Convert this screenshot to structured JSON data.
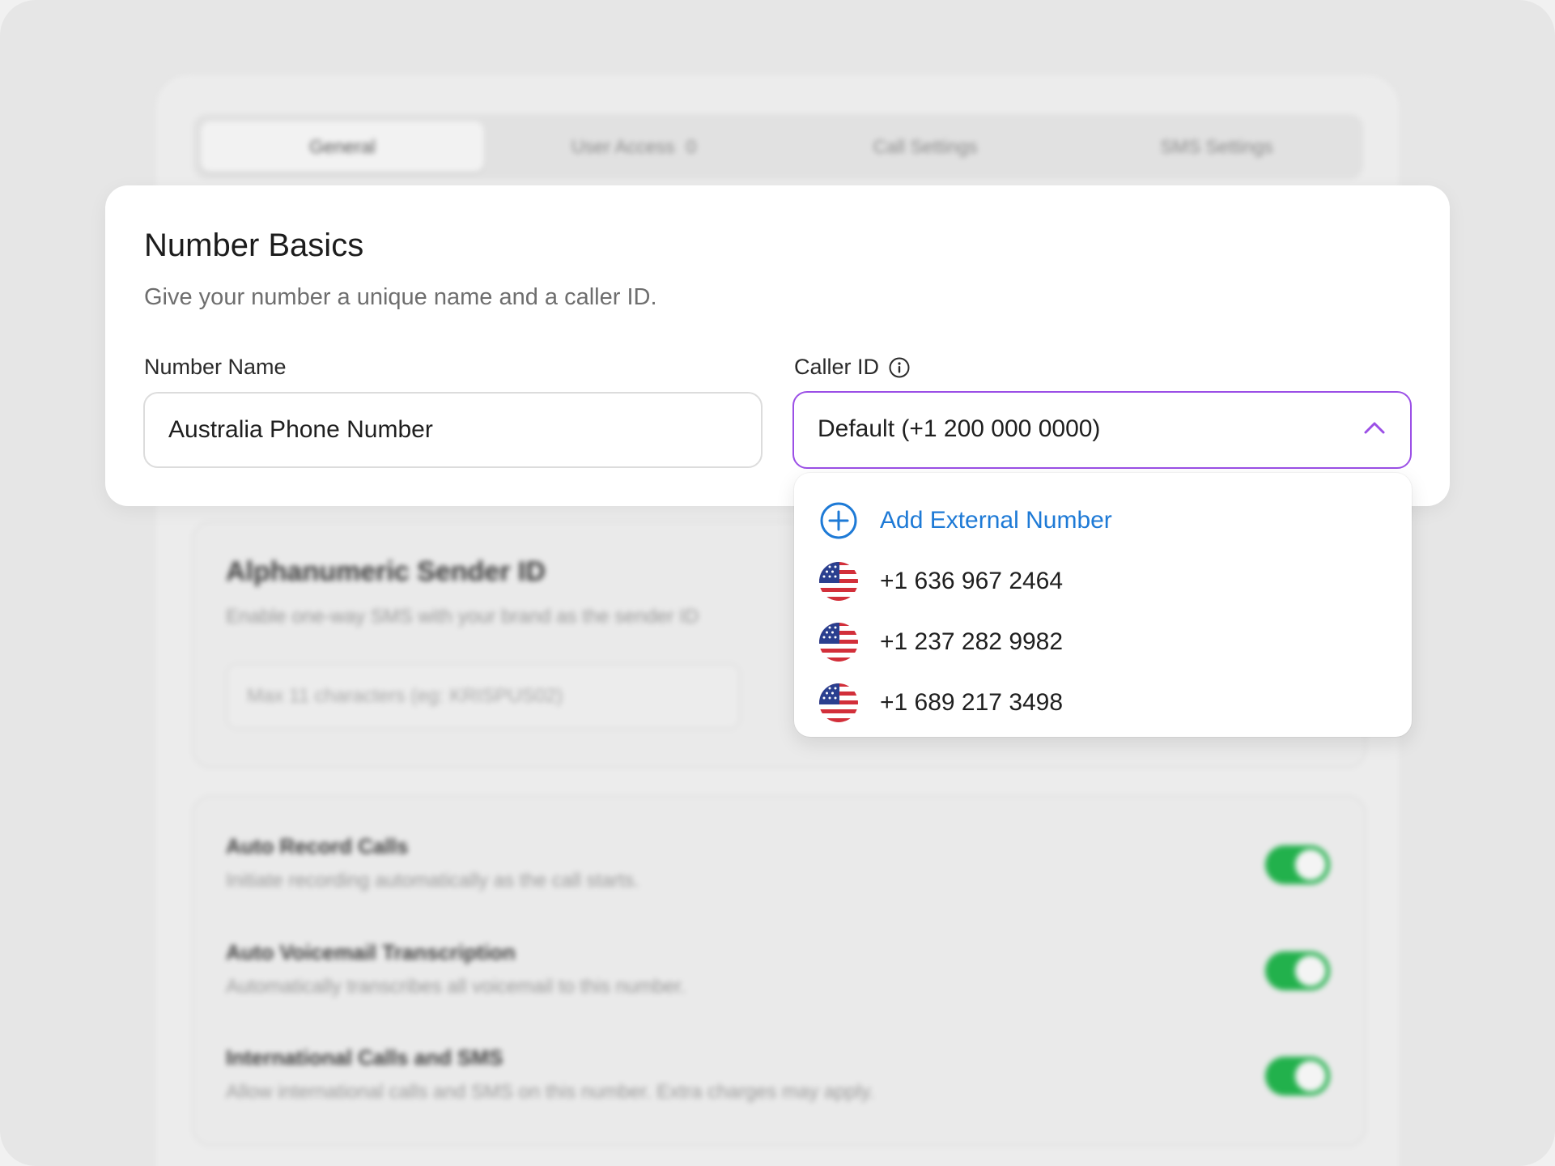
{
  "background": {
    "tabs": [
      {
        "label": "General",
        "active": true
      },
      {
        "label": "User Access",
        "count": "0"
      },
      {
        "label": "Call Settings"
      },
      {
        "label": "SMS Settings"
      }
    ],
    "sender_id": {
      "title": "Alphanumeric Sender ID",
      "subtitle": "Enable one-way SMS with your brand as the sender ID",
      "placeholder": "Max 11 characters (eg: KRISPUS02)"
    },
    "settings": [
      {
        "title": "Auto Record Calls",
        "subtitle": "Initiate recording automatically as the call starts.",
        "enabled": true
      },
      {
        "title": "Auto Voicemail Transcription",
        "subtitle": "Automatically transcribes all voicemail to this number.",
        "enabled": true
      },
      {
        "title": "International Calls and SMS",
        "subtitle": "Allow international calls and SMS on this number. Extra charges may apply.",
        "enabled": true
      }
    ]
  },
  "number_basics": {
    "title": "Number Basics",
    "subtitle": "Give your number a unique name and a caller ID.",
    "number_name": {
      "label": "Number Name",
      "value": "Australia Phone Number"
    },
    "caller_id": {
      "label": "Caller ID",
      "selected": "Default (+1 200 000 0000)",
      "dropdown": {
        "add_label": "Add External Number",
        "options": [
          "+1 636 967 2464",
          "+1 237 282 9982",
          "+1 689 217 3498"
        ]
      }
    }
  },
  "colors": {
    "accent_purple": "#9b4fe6",
    "link_blue": "#1e7ad6",
    "toggle_green": "#22b14c"
  },
  "icons": {
    "info": "info-icon",
    "chevron": "chevron-up-icon",
    "add": "plus-circle-icon",
    "flag": "us-flag-icon"
  }
}
